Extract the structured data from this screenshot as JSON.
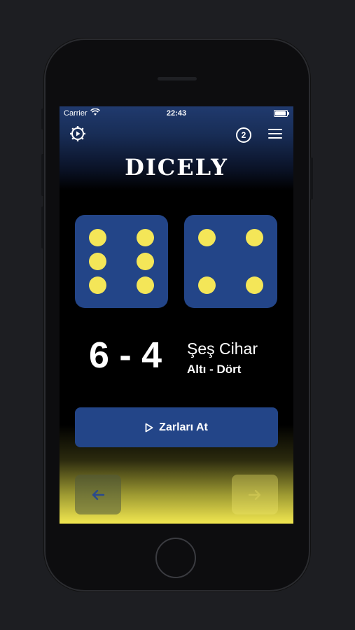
{
  "status_bar": {
    "carrier": "Carrier",
    "time": "22:43"
  },
  "header": {
    "settings_icon": "settings-gear-icon",
    "badge": "2",
    "menu_icon": "hamburger-icon"
  },
  "app": {
    "logo": "DICELY"
  },
  "dice": [
    {
      "value": 6
    },
    {
      "value": 4
    }
  ],
  "result": {
    "score": "6 - 4",
    "name": "Şeş Cihar",
    "words": "Altı - Dört"
  },
  "actions": {
    "roll_label": "Zarları At"
  },
  "colors": {
    "die": "#234588",
    "pip": "#f4e658",
    "accent_yellow": "#f1e750"
  }
}
